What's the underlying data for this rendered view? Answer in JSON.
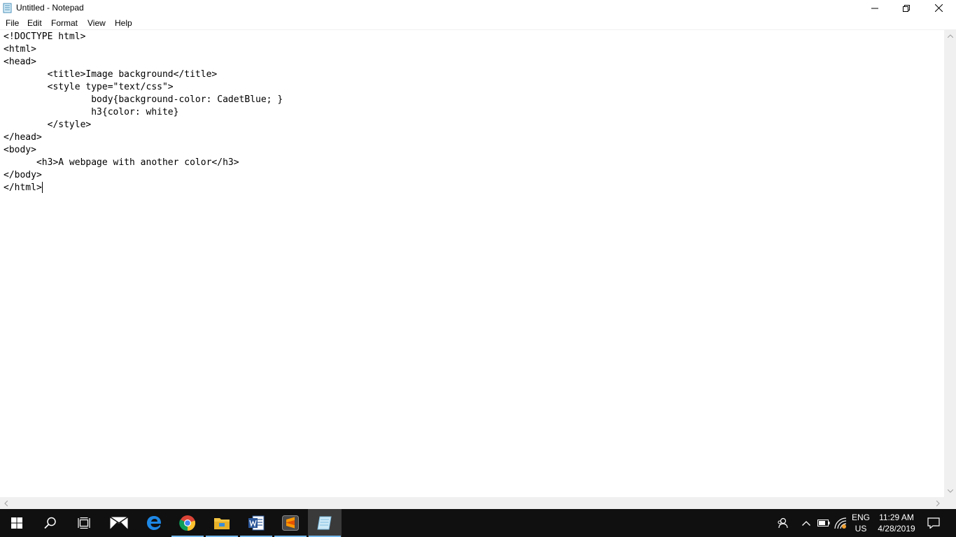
{
  "window": {
    "title": "Untitled - Notepad"
  },
  "menu": {
    "items": [
      "File",
      "Edit",
      "Format",
      "View",
      "Help"
    ]
  },
  "editor": {
    "text": "<!DOCTYPE html>\n<html>\n<head>\n        <title>Image background</title>\n        <style type=\"text/css\">\n                body{background-color: CadetBlue; }\n                h3{color: white}\n        </style>\n</head>\n<body>\n      <h3>A webpage with another color</h3>\n</body>\n</html>"
  },
  "taskbar": {
    "apps": [
      "start-icon",
      "search-icon",
      "task-view-icon",
      "mail-icon",
      "edge-icon",
      "chrome-icon",
      "file-explorer-icon",
      "word-icon",
      "sublime-text-icon",
      "notepad-icon"
    ],
    "active_app": "notepad-icon",
    "tray": {
      "lang_primary": "ENG",
      "lang_secondary": "US",
      "time": "11:29 AM",
      "date": "4/28/2019"
    }
  },
  "colors": {
    "taskbar_bg": "#101010",
    "taskbar_active": "#3a3a3a",
    "underline": "#76b9ed"
  }
}
